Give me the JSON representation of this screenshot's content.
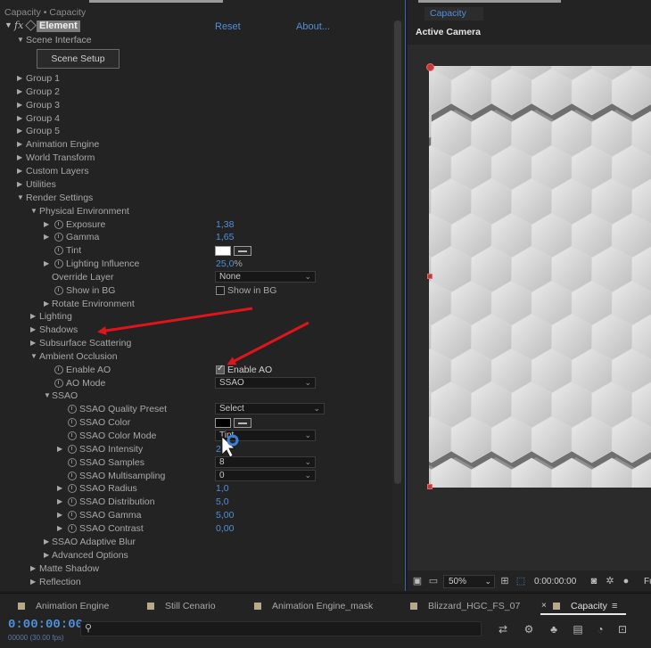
{
  "effect_controls": {
    "breadcrumb": "Capacity • Capacity",
    "effect_name": "Element",
    "reset_label": "Reset",
    "about_label": "About...",
    "scene_interface_label": "Scene Interface",
    "scene_setup_button": "Scene Setup",
    "groups": [
      "Group 1",
      "Group 2",
      "Group 3",
      "Group 4",
      "Group 5"
    ],
    "animation_engine": "Animation Engine",
    "world_transform": "World Transform",
    "custom_layers": "Custom Layers",
    "utilities": "Utilities",
    "render_settings": "Render Settings",
    "physical_environment": "Physical Environment",
    "exposure": {
      "label": "Exposure",
      "value": "1,38"
    },
    "gamma": {
      "label": "Gamma",
      "value": "1,65"
    },
    "tint": {
      "label": "Tint",
      "color": "#ffffff"
    },
    "lighting_influence": {
      "label": "Lighting Influence",
      "value": "25,0",
      "unit": "%"
    },
    "override_layer": {
      "label": "Override Layer",
      "value": "None"
    },
    "show_in_bg": {
      "label": "Show in BG",
      "checkbox_label": "Show in BG",
      "checked": false
    },
    "rotate_environment": "Rotate Environment",
    "lighting": "Lighting",
    "shadows": "Shadows",
    "subsurface_scattering": "Subsurface Scattering",
    "ambient_occlusion": "Ambient Occlusion",
    "enable_ao": {
      "label": "Enable AO",
      "checkbox_label": "Enable AO",
      "checked": true
    },
    "ao_mode": {
      "label": "AO Mode",
      "value": "SSAO"
    },
    "ssao": "SSAO",
    "ssao_quality_preset": {
      "label": "SSAO Quality Preset",
      "value": "Select"
    },
    "ssao_color": {
      "label": "SSAO Color",
      "color": "#000000"
    },
    "ssao_color_mode": {
      "label": "SSAO Color Mode",
      "value": "Tint"
    },
    "ssao_intensity": {
      "label": "SSAO Intensity",
      "value": "2"
    },
    "ssao_samples": {
      "label": "SSAO Samples",
      "value": "8"
    },
    "ssao_multisampling": {
      "label": "SSAO Multisampling",
      "value": "0"
    },
    "ssao_radius": {
      "label": "SSAO Radius",
      "value": "1,0"
    },
    "ssao_distribution": {
      "label": "SSAO Distribution",
      "value": "5,0"
    },
    "ssao_gamma": {
      "label": "SSAO Gamma",
      "value": "5,00"
    },
    "ssao_contrast": {
      "label": "SSAO Contrast",
      "value": "0,00"
    },
    "ssao_adaptive_blur": "SSAO Adaptive Blur",
    "advanced_options": "Advanced Options",
    "matte_shadow": "Matte Shadow",
    "reflection": "Reflection"
  },
  "composition": {
    "tab_label": "Capacity",
    "view_label": "Active Camera",
    "zoom": "50%",
    "timecode": "0:00:00:00",
    "toolbar_trailing": "Fu"
  },
  "timeline": {
    "tabs": [
      {
        "label": "Animation Engine"
      },
      {
        "label": "Still Cenario"
      },
      {
        "label": "Animation Engine_mask"
      },
      {
        "label": "Blizzard_HGC_FS_07"
      },
      {
        "label": "Capacity"
      }
    ],
    "close_glyph": "×",
    "menu_glyph": "≡",
    "current_time": "0:00:00:00",
    "fps": "00000 (30.00 fps)",
    "search_placeholder": ""
  },
  "colors": {
    "accent_blue": "#4f90d9",
    "annotation_red": "#e0141b",
    "panel_bg": "#232323"
  }
}
